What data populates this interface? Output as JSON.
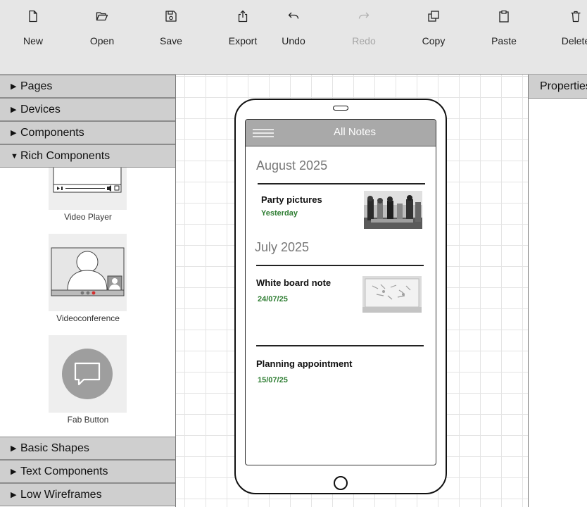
{
  "toolbar": {
    "new_label": "New",
    "open_label": "Open",
    "save_label": "Save",
    "export_label": "Export",
    "undo_label": "Undo",
    "redo_label": "Redo",
    "copy_label": "Copy",
    "paste_label": "Paste",
    "delete_label": "Delete"
  },
  "left_panel": {
    "sections": {
      "pages": "Pages",
      "devices": "Devices",
      "components": "Components",
      "rich_components": "Rich Components",
      "basic_shapes": "Basic Shapes",
      "text_components": "Text Components",
      "low_wireframes": "Low Wireframes"
    },
    "library_items": {
      "video_player": "Video Player",
      "videoconference": "Videoconference",
      "fab_button": "Fab Button"
    }
  },
  "canvas": {
    "app_title": "All Notes",
    "sections": [
      {
        "title": "August 2025",
        "notes": [
          {
            "title": "Party pictures",
            "date": "Yesterday"
          }
        ]
      },
      {
        "title": "July 2025",
        "notes": [
          {
            "title": "White board note",
            "date": "24/07/25"
          },
          {
            "title": "Planning appointment",
            "date": "15/07/25"
          }
        ]
      }
    ]
  },
  "right_panel": {
    "title": "Properties"
  },
  "colors": {
    "toolbar_bg": "#e6e6e6",
    "section_header_bg": "#cfcfcf",
    "app_bar_bg": "#a9a9a9",
    "date_green": "#2e7d32",
    "disabled_text": "#a6a6a6"
  }
}
